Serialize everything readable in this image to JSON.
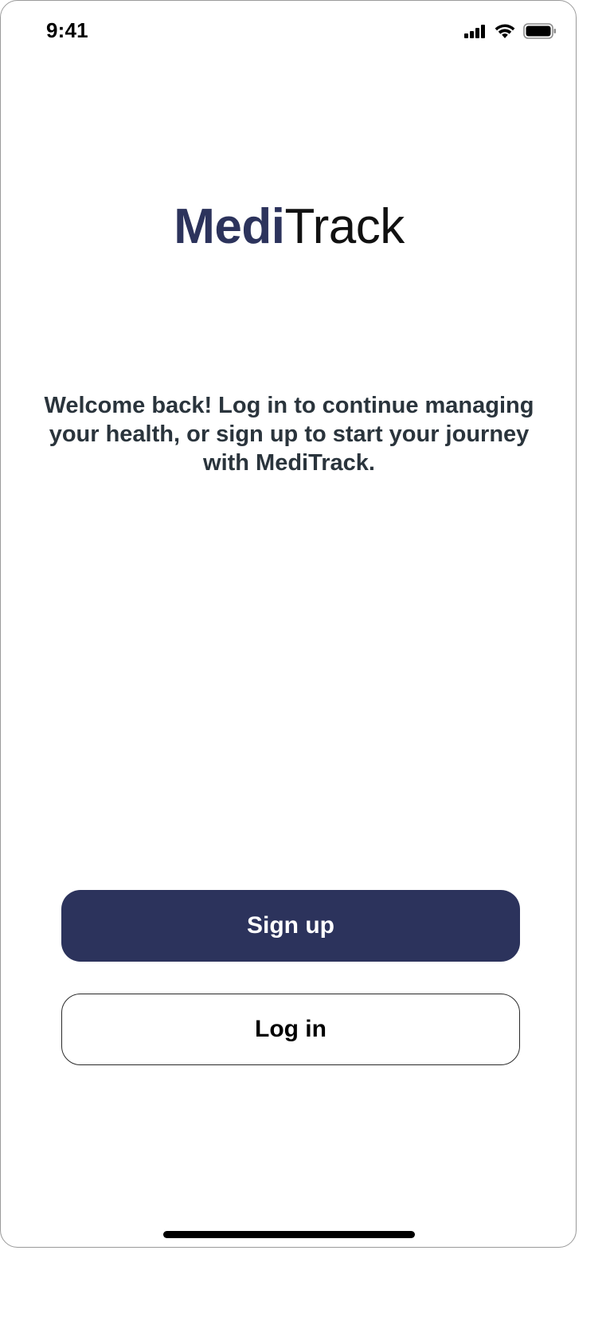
{
  "status_bar": {
    "time": "9:41",
    "icons": [
      "cellular-signal-icon",
      "wifi-icon",
      "battery-icon"
    ]
  },
  "logo": {
    "bold_part": "Medi",
    "light_part": "Track"
  },
  "welcome_message": "Welcome back! Log in to continue managing your health, or sign up to start your journey with MediTrack.",
  "buttons": {
    "signup_label": "Sign up",
    "login_label": "Log in"
  },
  "colors": {
    "brand": "#2c335c",
    "text": "#2a343c",
    "background": "#ffffff"
  }
}
